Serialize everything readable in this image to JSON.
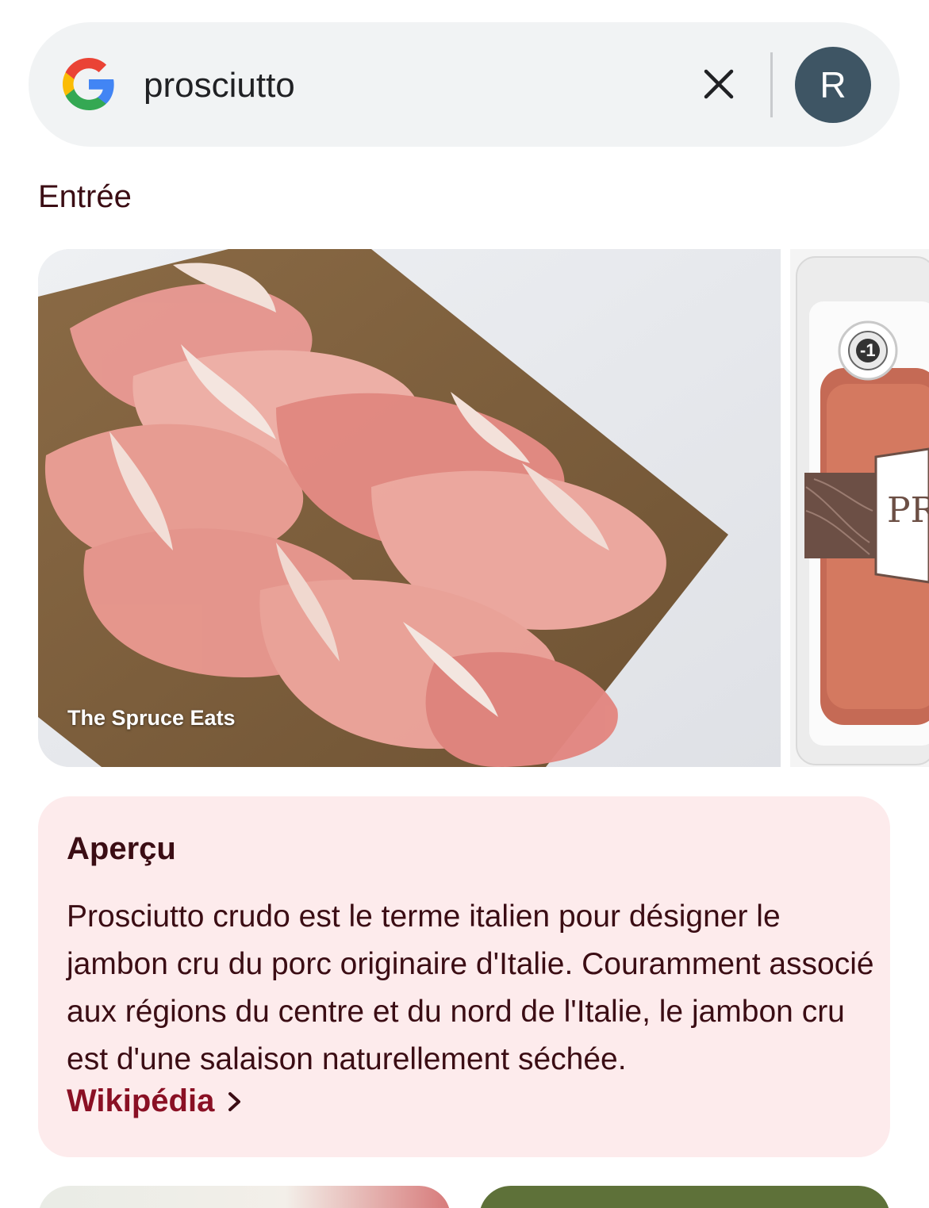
{
  "search": {
    "query": "prosciutto",
    "avatar_letter": "R"
  },
  "category": "Entrée",
  "images": {
    "main_caption": "The Spruce Eats",
    "second_label": "PR",
    "badge": "-1"
  },
  "overview": {
    "title": "Aperçu",
    "text": "Prosciutto crudo est le terme italien pour désigner le jambon cru du porc originaire d'Italie. Couramment associé aux régions du centre et du nord de l'Italie, le jambon cru est d'une salaison naturellement séchée.",
    "source_label": "Wikipédia"
  },
  "colors": {
    "avatar_bg": "#3e5564",
    "card_bg": "#fdebec",
    "link": "#8a1024",
    "text": "#3b0d14"
  }
}
